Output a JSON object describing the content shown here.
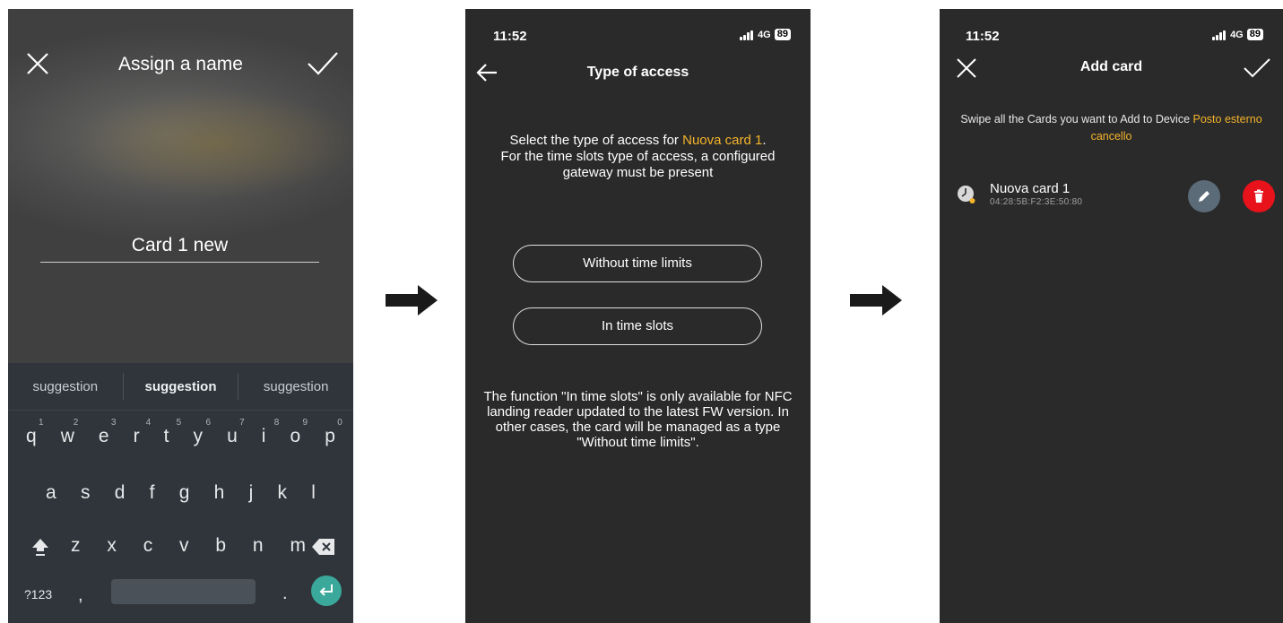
{
  "screen1": {
    "title": "Assign a name",
    "name_value": "Card 1 new",
    "suggestions": [
      "suggestion",
      "suggestion",
      "suggestion"
    ],
    "keyboard": {
      "row1": [
        {
          "k": "q",
          "n": "1"
        },
        {
          "k": "w",
          "n": "2"
        },
        {
          "k": "e",
          "n": "3"
        },
        {
          "k": "r",
          "n": "4"
        },
        {
          "k": "t",
          "n": "5"
        },
        {
          "k": "y",
          "n": "6"
        },
        {
          "k": "u",
          "n": "7"
        },
        {
          "k": "i",
          "n": "8"
        },
        {
          "k": "o",
          "n": "9"
        },
        {
          "k": "p",
          "n": "0"
        }
      ],
      "row2": [
        "a",
        "s",
        "d",
        "f",
        "g",
        "h",
        "j",
        "k",
        "l"
      ],
      "row3": [
        "z",
        "x",
        "c",
        "v",
        "b",
        "n",
        "m"
      ],
      "symbols_label": "?123",
      "comma": ",",
      "period": "."
    }
  },
  "screen2": {
    "status": {
      "time": "11:52",
      "network": "4G",
      "battery": "89"
    },
    "title": "Type of access",
    "intro_prefix": "Select the type of access for ",
    "intro_card": "Nuova card 1",
    "intro_suffix": ".",
    "intro_line2": "For the time slots type of access, a configured gateway must be present",
    "option1": "Without time limits",
    "option2": "In time slots",
    "note": "The function \"In time slots\" is only available for NFC landing reader updated to the latest FW version. In other cases, the card will be managed as a type \"Without time limits\"."
  },
  "screen3": {
    "status": {
      "time": "11:52",
      "network": "4G",
      "battery": "89"
    },
    "title": "Add card",
    "intro_prefix": "Swipe all the Cards you want to Add to Device ",
    "intro_device": "Posto esterno cancello",
    "card": {
      "name": "Nuova card 1",
      "uid": "04:28:5B:F2:3E:50:80"
    }
  },
  "colors": {
    "accent": "#f5b42a",
    "delete": "#e8121b",
    "edit": "#5c6b78",
    "enter": "#3aa89a"
  }
}
